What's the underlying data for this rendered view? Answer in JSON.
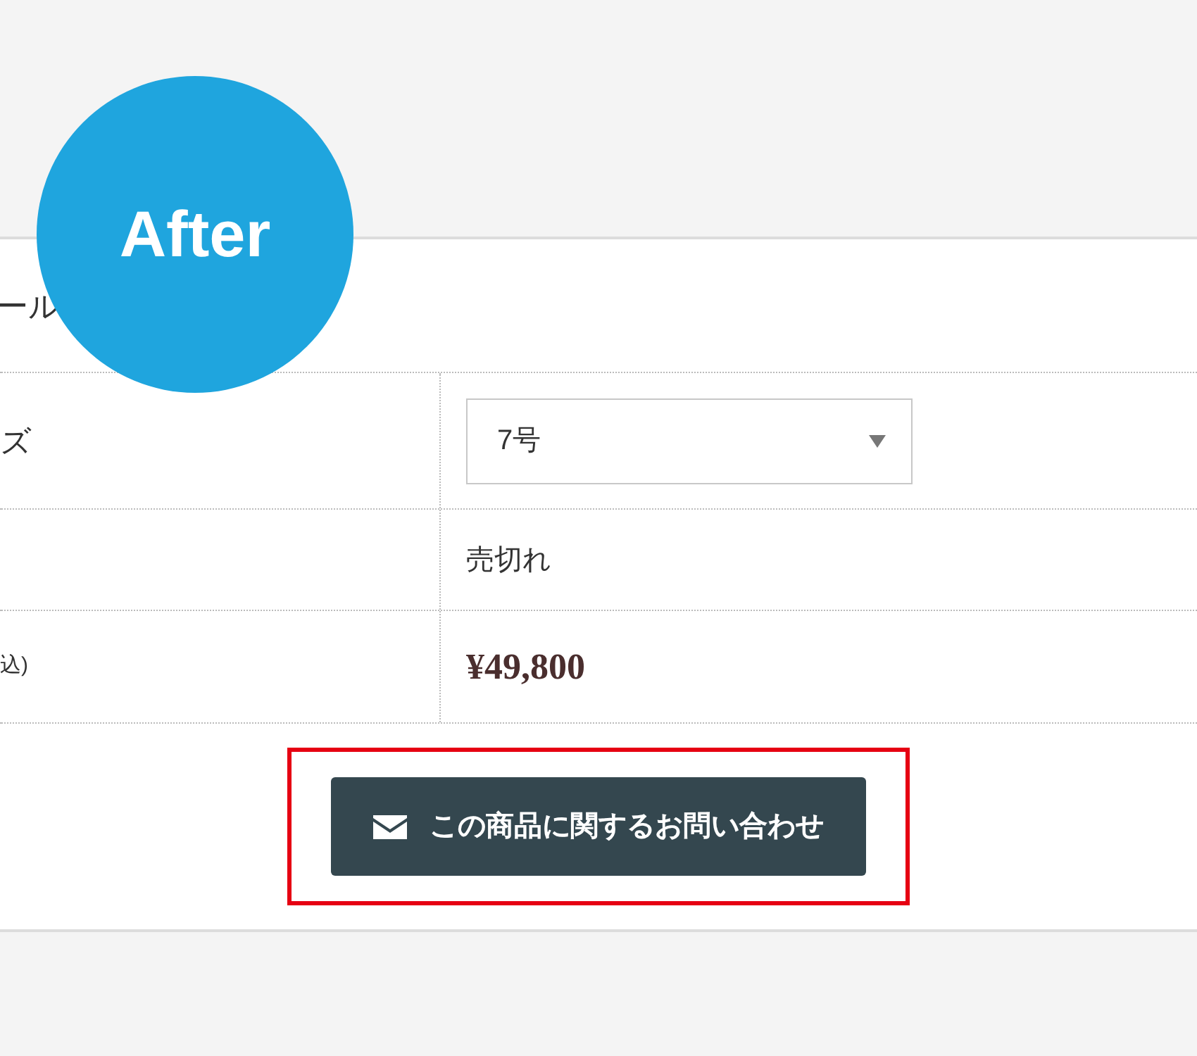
{
  "badge": {
    "label": "After"
  },
  "section_title": "ール",
  "rows": [
    {
      "label": "ズ",
      "kind": "select",
      "value": "7号"
    },
    {
      "label": "",
      "kind": "text",
      "value": "売切れ"
    },
    {
      "label": "込)",
      "kind": "price",
      "value": "¥49,800"
    }
  ],
  "inquiry_button": {
    "label": "この商品に関するお問い合わせ",
    "highlighted": true
  }
}
